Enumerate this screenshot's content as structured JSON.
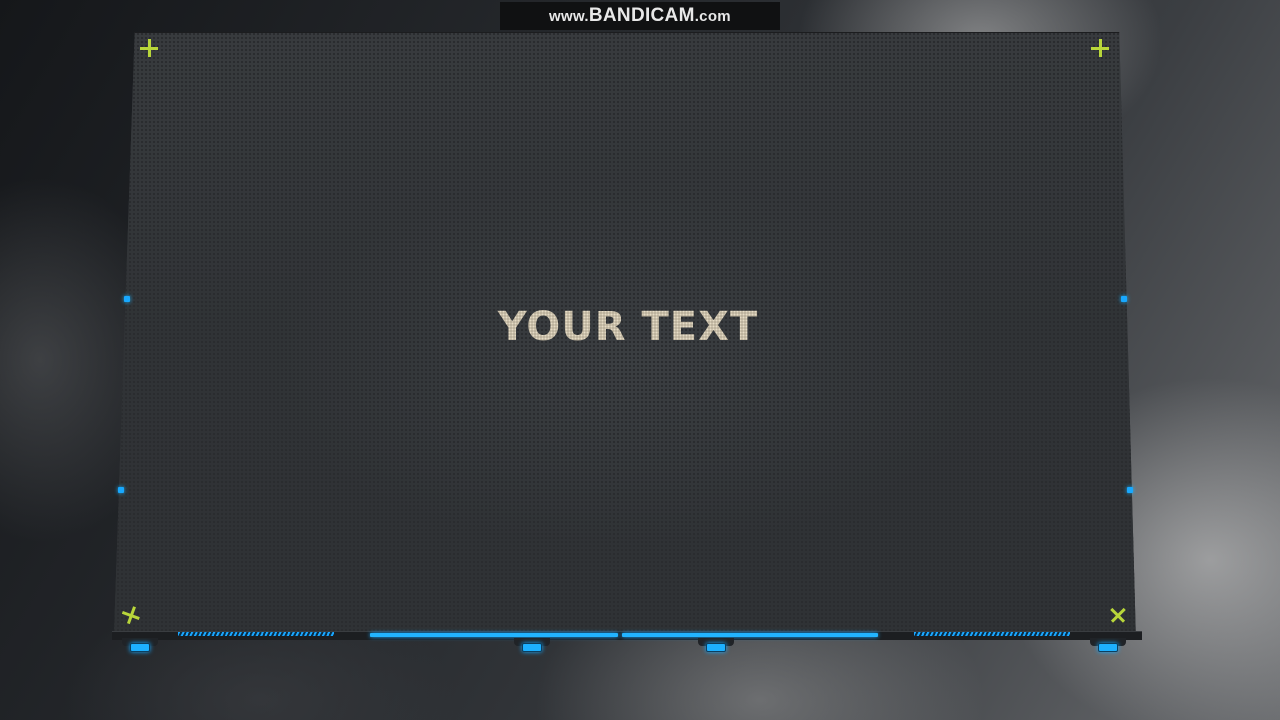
{
  "watermark": {
    "prefix": "www.",
    "brand": "BANDICAM",
    "suffix": ".com"
  },
  "panel": {
    "title": "YOUR TEXT"
  },
  "colors": {
    "accent_blue": "#1db0ff",
    "marker_green": "#b8d63a",
    "title_color": "#d8cdb8",
    "panel_bg": "#34373a"
  },
  "icons": {
    "corner_markers": [
      "plus-icon",
      "plus-icon",
      "cross-icon",
      "cross-icon"
    ]
  }
}
